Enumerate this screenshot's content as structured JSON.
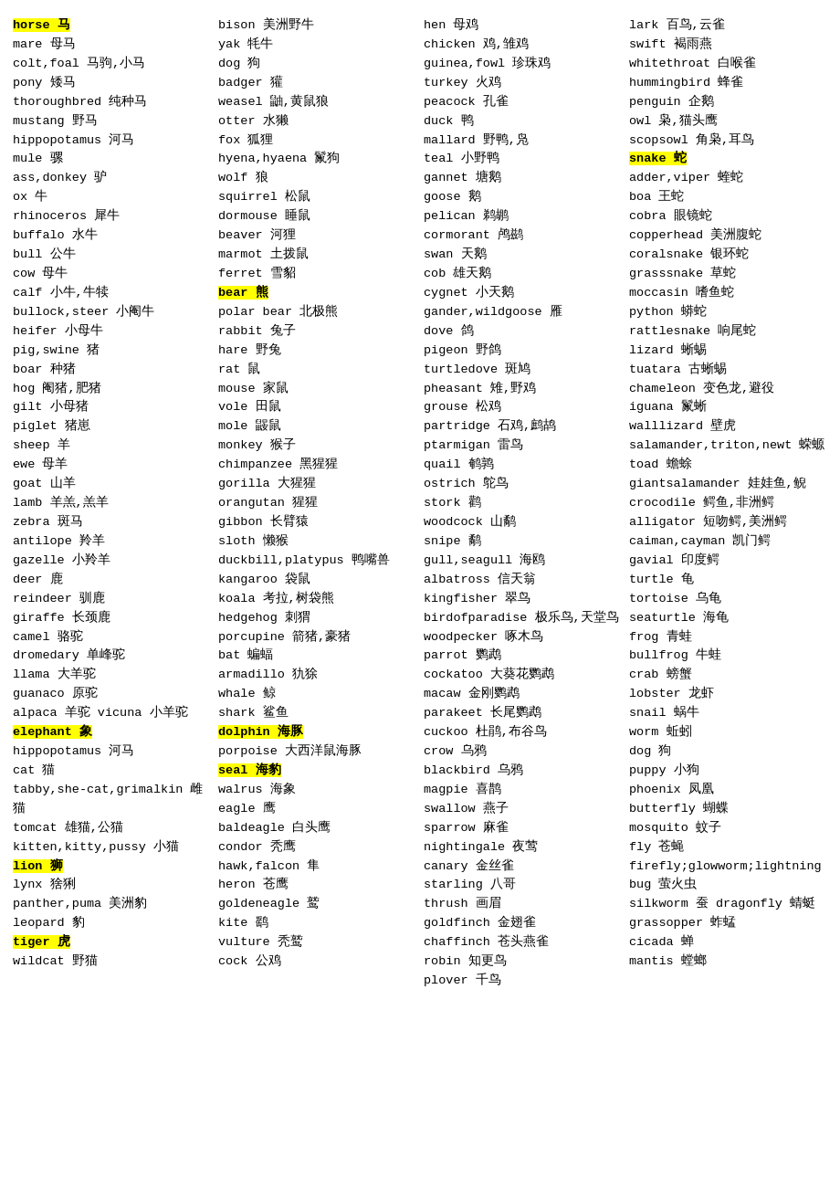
{
  "columns": [
    {
      "id": "col1",
      "entries": [
        {
          "text": "horse 马",
          "highlight": true
        },
        {
          "text": "mare 母马"
        },
        {
          "text": "colt,foal 马驹,小马"
        },
        {
          "text": "pony 矮马"
        },
        {
          "text": "thoroughbred 纯种马"
        },
        {
          "text": "mustang 野马"
        },
        {
          "text": "hippopotamus 河马"
        },
        {
          "text": "mule 骡"
        },
        {
          "text": "ass,donkey 驴"
        },
        {
          "text": "ox 牛"
        },
        {
          "text": "rhinoceros 犀牛"
        },
        {
          "text": "buffalo 水牛"
        },
        {
          "text": "bull 公牛"
        },
        {
          "text": "cow 母牛"
        },
        {
          "text": "calf 小牛,牛犊"
        },
        {
          "text": "bullock,steer 小阉牛"
        },
        {
          "text": "heifer 小母牛"
        },
        {
          "text": "pig,swine 猪"
        },
        {
          "text": "boar 种猪"
        },
        {
          "text": "hog 阉猪,肥猪"
        },
        {
          "text": "gilt 小母猪"
        },
        {
          "text": "piglet 猪崽"
        },
        {
          "text": "sheep 羊"
        },
        {
          "text": "ewe 母羊"
        },
        {
          "text": "goat 山羊"
        },
        {
          "text": "lamb 羊羔,羔羊"
        },
        {
          "text": "zebra 斑马"
        },
        {
          "text": "antilope 羚羊"
        },
        {
          "text": "gazelle 小羚羊"
        },
        {
          "text": "deer 鹿"
        },
        {
          "text": "reindeer 驯鹿"
        },
        {
          "text": "giraffe 长颈鹿"
        },
        {
          "text": "camel 骆驼"
        },
        {
          "text": "dromedary 单峰驼"
        },
        {
          "text": "llama 大羊驼"
        },
        {
          "text": "guanaco 原驼"
        },
        {
          "text": "alpaca 羊驼   vicuna 小羊驼"
        },
        {
          "text": "elephant 象",
          "highlight": true
        },
        {
          "text": "hippopotamus 河马"
        },
        {
          "text": "cat 猫"
        },
        {
          "text": "tabby,she-cat,grimalkin 雌猫"
        },
        {
          "text": "tomcat 雄猫,公猫"
        },
        {
          "text": "kitten,kitty,pussy 小猫"
        },
        {
          "text": "lion 狮",
          "highlight": true
        },
        {
          "text": "lynx 猞猁"
        },
        {
          "text": "panther,puma 美洲豹"
        },
        {
          "text": "leopard 豹"
        },
        {
          "text": "tiger 虎",
          "highlight": true
        },
        {
          "text": "wildcat 野猫"
        }
      ]
    },
    {
      "id": "col2",
      "entries": [
        {
          "text": "bison 美洲野牛"
        },
        {
          "text": "yak 牦牛"
        },
        {
          "text": "dog 狗"
        },
        {
          "text": "badger 獾"
        },
        {
          "text": "weasel 鼬,黄鼠狼"
        },
        {
          "text": "otter 水獭"
        },
        {
          "text": "fox 狐狸"
        },
        {
          "text": "hyena,hyaena 鬣狗"
        },
        {
          "text": "wolf 狼"
        },
        {
          "text": "squirrel 松鼠"
        },
        {
          "text": "dormouse 睡鼠"
        },
        {
          "text": "beaver 河狸"
        },
        {
          "text": "marmot 土拨鼠"
        },
        {
          "text": "ferret 雪貂"
        },
        {
          "text": "bear 熊",
          "highlight": true
        },
        {
          "text": "polar bear 北极熊"
        },
        {
          "text": "rabbit 兔子"
        },
        {
          "text": "hare 野兔"
        },
        {
          "text": "rat 鼠"
        },
        {
          "text": "mouse 家鼠"
        },
        {
          "text": "vole 田鼠"
        },
        {
          "text": "mole 鼹鼠"
        },
        {
          "text": "monkey 猴子"
        },
        {
          "text": "chimpanzee 黑猩猩"
        },
        {
          "text": "gorilla 大猩猩"
        },
        {
          "text": "orangutan 猩猩"
        },
        {
          "text": "gibbon 长臂猿"
        },
        {
          "text": "sloth 懒猴"
        },
        {
          "text": "duckbill,platypus 鸭嘴兽"
        },
        {
          "text": "kangaroo 袋鼠"
        },
        {
          "text": "koala 考拉,树袋熊"
        },
        {
          "text": "hedgehog 刺猬"
        },
        {
          "text": "porcupine 箭猪,豪猪"
        },
        {
          "text": "bat 蝙蝠"
        },
        {
          "text": "armadillo 犰狳"
        },
        {
          "text": "whale 鲸"
        },
        {
          "text": "shark 鲨鱼"
        },
        {
          "text": "dolphin 海豚",
          "highlight": true
        },
        {
          "text": "porpoise 大西洋鼠海豚"
        },
        {
          "text": "seal 海豹",
          "highlight": true
        },
        {
          "text": "walrus 海象"
        },
        {
          "text": "eagle 鹰"
        },
        {
          "text": "baldeagle 白头鹰"
        },
        {
          "text": "condor 秃鹰"
        },
        {
          "text": "hawk,falcon 隼"
        },
        {
          "text": "heron 苍鹰"
        },
        {
          "text": "goldeneagle 鹫"
        },
        {
          "text": "kite 鹞"
        },
        {
          "text": "vulture 秃鹫"
        },
        {
          "text": "cock 公鸡"
        }
      ]
    },
    {
      "id": "col3",
      "entries": [
        {
          "text": "hen 母鸡"
        },
        {
          "text": "chicken 鸡,雏鸡"
        },
        {
          "text": "guinea,fowl 珍珠鸡"
        },
        {
          "text": "turkey 火鸡"
        },
        {
          "text": "peacock 孔雀"
        },
        {
          "text": "duck 鸭"
        },
        {
          "text": "mallard 野鸭,凫"
        },
        {
          "text": "teal 小野鸭"
        },
        {
          "text": "gannet 塘鹅"
        },
        {
          "text": "goose 鹅"
        },
        {
          "text": " pelican 鹈鹕"
        },
        {
          "text": "cormorant 鸬鹚"
        },
        {
          "text": "swan 天鹅"
        },
        {
          "text": "cob 雄天鹅"
        },
        {
          "text": "cygnet 小天鹅"
        },
        {
          "text": "gander,wildgoose 雁"
        },
        {
          "text": "dove 鸽"
        },
        {
          "text": "pigeon 野鸽"
        },
        {
          "text": "turtledove 斑鸠"
        },
        {
          "text": "pheasant 雉,野鸡"
        },
        {
          "text": "grouse 松鸡"
        },
        {
          "text": "partridge 石鸡,鹧鸪"
        },
        {
          "text": "ptarmigan 雷鸟"
        },
        {
          "text": "quail 鹌鹑"
        },
        {
          "text": "ostrich 鸵鸟"
        },
        {
          "text": "stork 鹳"
        },
        {
          "text": "woodcock 山鹬"
        },
        {
          "text": "snipe 鹬"
        },
        {
          "text": "gull,seagull 海鸥"
        },
        {
          "text": "albatross 信天翁"
        },
        {
          "text": "kingfisher 翠鸟"
        },
        {
          "text": "birdofparadise 极乐鸟,天堂鸟"
        },
        {
          "text": "woodpecker 啄木鸟"
        },
        {
          "text": "parrot 鹦鹉"
        },
        {
          "text": "cockatoo 大葵花鹦鹉"
        },
        {
          "text": "macaw 金刚鹦鹉"
        },
        {
          "text": "parakeet 长尾鹦鹉"
        },
        {
          "text": "cuckoo 杜鹃,布谷鸟"
        },
        {
          "text": "crow 乌鸦"
        },
        {
          "text": "blackbird 乌鸦"
        },
        {
          "text": "magpie 喜鹊"
        },
        {
          "text": "swallow 燕子"
        },
        {
          "text": "sparrow 麻雀"
        },
        {
          "text": "nightingale 夜莺"
        },
        {
          "text": "canary 金丝雀"
        },
        {
          "text": "starling 八哥"
        },
        {
          "text": "thrush 画眉"
        },
        {
          "text": "goldfinch 金翅雀"
        },
        {
          "text": "chaffinch 苍头燕雀"
        },
        {
          "text": "robin 知更鸟"
        },
        {
          "text": "plover 千鸟"
        }
      ]
    },
    {
      "id": "col4",
      "entries": [
        {
          "text": "lark 百鸟,云雀"
        },
        {
          "text": "swift 褐雨燕"
        },
        {
          "text": "whitethroat 白喉雀"
        },
        {
          "text": "hummingbird 蜂雀"
        },
        {
          "text": "penguin 企鹅"
        },
        {
          "text": "owl 枭,猫头鹰"
        },
        {
          "text": "scopsowl 角枭,耳鸟"
        },
        {
          "text": "snake 蛇",
          "highlight": true
        },
        {
          "text": "adder,viper 蝰蛇"
        },
        {
          "text": "boa 王蛇"
        },
        {
          "text": "cobra 眼镜蛇"
        },
        {
          "text": "copperhead 美洲腹蛇"
        },
        {
          "text": "coralsnake 银环蛇"
        },
        {
          "text": "grasssnake 草蛇"
        },
        {
          "text": "moccasin 嗜鱼蛇"
        },
        {
          "text": "python 蟒蛇"
        },
        {
          "text": "rattlesnake 响尾蛇"
        },
        {
          "text": "lizard 蜥蜴"
        },
        {
          "text": "tuatara 古蜥蜴"
        },
        {
          "text": "chameleon 变色龙,避役"
        },
        {
          "text": "iguana 鬣蜥"
        },
        {
          "text": "walllizard 壁虎"
        },
        {
          "text": "salamander,triton,newt 蝾螈"
        },
        {
          "text": "toad 蟾蜍"
        },
        {
          "text": "giantsalamander 娃娃鱼,鲵"
        },
        {
          "text": "crocodile 鳄鱼,非洲鳄"
        },
        {
          "text": "alligator 短吻鳄,美洲鳄"
        },
        {
          "text": "caiman,cayman 凯门鳄"
        },
        {
          "text": "gavial 印度鳄"
        },
        {
          "text": "turtle 龟"
        },
        {
          "text": "tortoise 乌龟"
        },
        {
          "text": "seaturtle 海龟"
        },
        {
          "text": "frog 青蛙"
        },
        {
          "text": "bullfrog 牛蛙"
        },
        {
          "text": "crab 螃蟹"
        },
        {
          "text": "lobster 龙虾"
        },
        {
          "text": "snail 蜗牛"
        },
        {
          "text": "worm 蚯蚓"
        },
        {
          "text": "dog 狗"
        },
        {
          "text": "puppy 小狗"
        },
        {
          "text": "phoenix 凤凰"
        },
        {
          "text": "butterfly 蝴蝶"
        },
        {
          "text": "mosquito 蚊子"
        },
        {
          "text": "fly 苍蝇"
        },
        {
          "text": "firefly;glowworm;lightning bug 萤火虫"
        },
        {
          "text": "silkworm 蚕    dragonfly 蜻蜓 grassopper 蚱蜢"
        },
        {
          "text": "cicada 蝉"
        },
        {
          "text": "mantis 螳螂"
        }
      ]
    }
  ]
}
